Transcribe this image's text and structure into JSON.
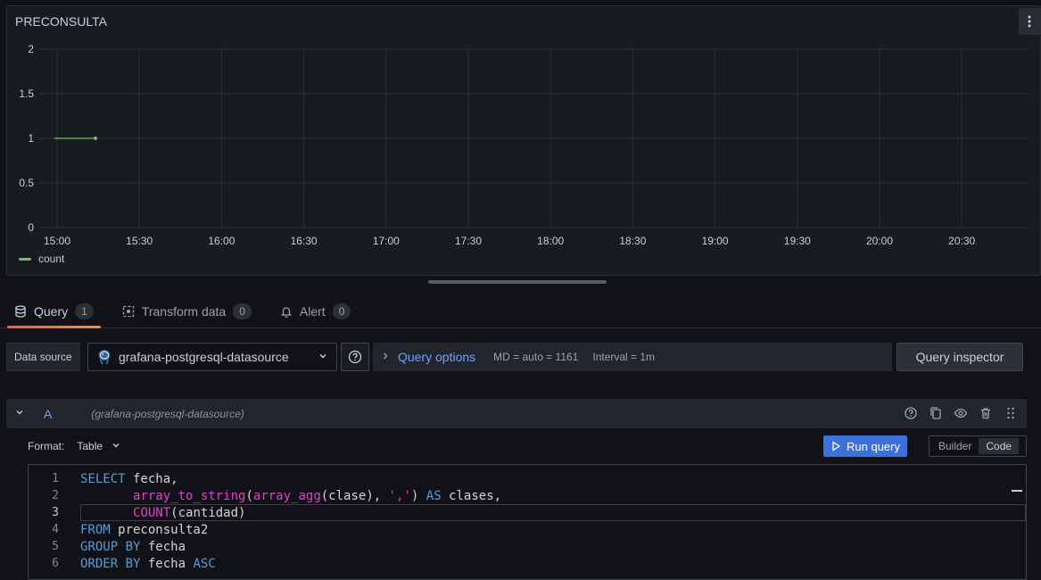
{
  "panel": {
    "title": "PRECONSULTA",
    "menu_icon": "kebab-vertical-icon"
  },
  "chart_data": {
    "type": "line",
    "title": "PRECONSULTA",
    "x_ticks": [
      "15:00",
      "15:30",
      "16:00",
      "16:30",
      "17:00",
      "17:30",
      "18:00",
      "18:30",
      "19:00",
      "19:30",
      "20:00",
      "20:30"
    ],
    "y_ticks": [
      "0",
      "0.5",
      "1",
      "1.5",
      "2"
    ],
    "ylim": [
      0,
      2
    ],
    "series": [
      {
        "name": "count",
        "color": "#73bf69",
        "x": [
          "14:59",
          "15:14"
        ],
        "values": [
          1,
          1
        ]
      }
    ],
    "grid": true,
    "legend_position": "bottom-left"
  },
  "legend": {
    "series_name": "count"
  },
  "tabs": [
    {
      "label": "Query",
      "count": "1",
      "icon": "database-icon",
      "active": true
    },
    {
      "label": "Transform data",
      "count": "0",
      "icon": "transform-icon",
      "active": false
    },
    {
      "label": "Alert",
      "count": "0",
      "icon": "bell-icon",
      "active": false
    }
  ],
  "datasource": {
    "label": "Data source",
    "selected": "grafana-postgresql-datasource",
    "help_icon": "question-circle-icon"
  },
  "query_options": {
    "title": "Query options",
    "md": "MD = auto = 1161",
    "interval": "Interval = 1m"
  },
  "query_inspector": {
    "label": "Query inspector"
  },
  "query": {
    "ref_id": "A",
    "datasource": "(grafana-postgresql-datasource)",
    "format_label": "Format:",
    "format_value": "Table",
    "run_label": "Run query",
    "mode_builder": "Builder",
    "mode_code": "Code"
  },
  "editor": {
    "line_numbers": [
      "1",
      "2",
      "3",
      "4",
      "5",
      "6"
    ]
  }
}
